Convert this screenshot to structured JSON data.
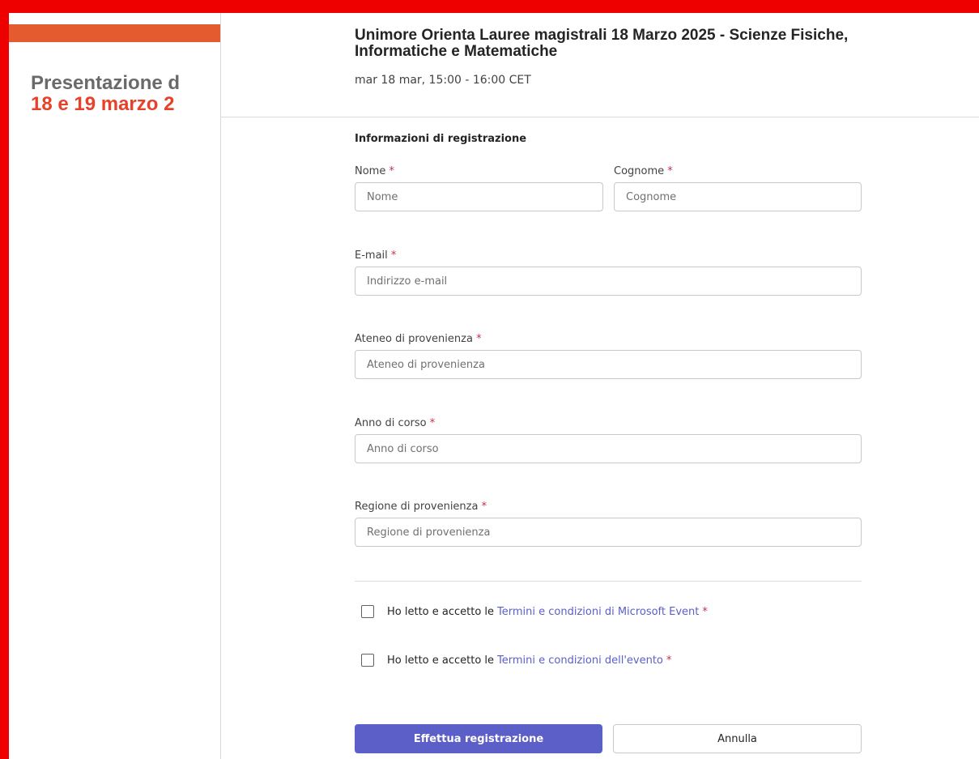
{
  "background": {
    "title_line1": "Presentazione d",
    "title_line2": "18 e 19 marzo 2"
  },
  "event": {
    "title": "Unimore Orienta Lauree magistrali 18 Marzo 2025 - Scienze Fisiche, Informatiche e Matematiche",
    "time": "mar 18 mar, 15:00 - 16:00 CET"
  },
  "form": {
    "section_label": "Informazioni di registrazione",
    "required_mark": "*",
    "fields": {
      "nome": {
        "label": "Nome",
        "placeholder": "Nome",
        "value": ""
      },
      "cognome": {
        "label": "Cognome",
        "placeholder": "Cognome",
        "value": ""
      },
      "email": {
        "label": "E-mail",
        "placeholder": "Indirizzo e-mail",
        "value": ""
      },
      "ateneo": {
        "label": "Ateneo di provenienza",
        "placeholder": "Ateneo di provenienza",
        "value": ""
      },
      "anno": {
        "label": "Anno di corso",
        "placeholder": "Anno di corso",
        "value": ""
      },
      "regione": {
        "label": "Regione di provenienza",
        "placeholder": "Regione di provenienza",
        "value": ""
      }
    },
    "consents": [
      {
        "text": "Ho letto e accetto le",
        "link": "Termini e condizioni di Microsoft Event",
        "checked": false
      },
      {
        "text": "Ho letto e accetto le",
        "link": "Termini e condizioni dell'evento",
        "checked": false
      }
    ],
    "submit_label": "Effettua registrazione",
    "cancel_label": "Annulla"
  }
}
